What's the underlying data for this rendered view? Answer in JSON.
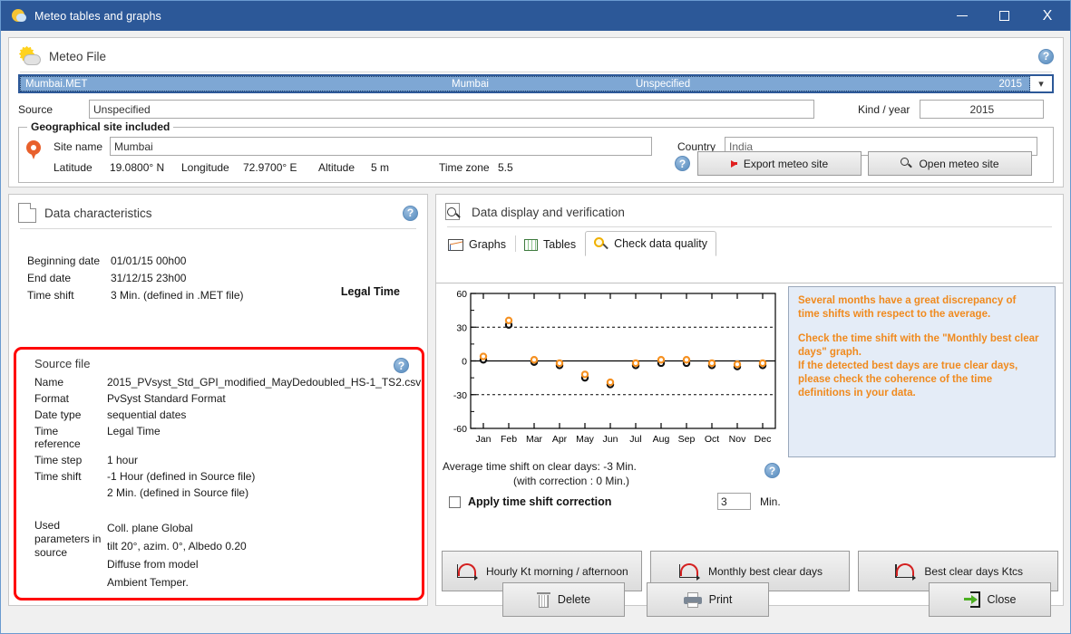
{
  "window": {
    "title": "Meteo tables and graphs",
    "icon": "sun-cloud-icon",
    "minimize": "–",
    "maximize": "□",
    "close": "X"
  },
  "meteo_file": {
    "section_title": "Meteo File",
    "file_row": {
      "file_name": "Mumbai.MET",
      "site": "Mumbai",
      "source": "Unspecified",
      "year": "2015",
      "dropdown_arrow": "chevron-down-icon"
    },
    "source_label": "Source",
    "source_value": "Unspecified",
    "kind_year_label": "Kind / year",
    "kind_year_value": "2015",
    "geo": {
      "group_title": "Geographical site included",
      "site_name_label": "Site name",
      "site_name_value": "Mumbai",
      "country_label": "Country",
      "country_value": "India",
      "latitude_label": "Latitude",
      "latitude_value": "19.0800° N",
      "longitude_label": "Longitude",
      "longitude_value": "72.9700° E",
      "altitude_label": "Altitude",
      "altitude_value": "5 m",
      "timezone_label": "Time zone",
      "timezone_value": "5.5",
      "export_button": "Export meteo site",
      "open_button": "Open meteo site"
    }
  },
  "data_characteristics": {
    "section_title": "Data characteristics",
    "legal_time": "Legal Time",
    "rows": [
      {
        "key": "Beginning date",
        "value": "01/01/15 00h00"
      },
      {
        "key": "End date",
        "value": "31/12/15 23h00"
      },
      {
        "key": "Time shift",
        "value": "3 Min. (defined in .MET file)"
      }
    ],
    "source_file": {
      "title": "Source file",
      "rows": [
        {
          "key": "Name",
          "value": "2015_PVsyst_Std_GPI_modified_MayDedoubled_HS-1_TS2.csv"
        },
        {
          "key": "Format",
          "value": "PvSyst Standard Format"
        },
        {
          "key": "Date type",
          "value": "sequential dates"
        },
        {
          "key": "Time reference",
          "value": "Legal Time"
        },
        {
          "key": "Time step",
          "value": "1 hour"
        },
        {
          "key": "Time shift",
          "value": "-1 Hour (defined in Source file)"
        },
        {
          "key": "",
          "value": "2 Min. (defined in Source file)"
        }
      ],
      "used_params_label": "Used parameters in source",
      "used_params": [
        "Coll. plane Global",
        "tilt 20°, azim. 0°, Albedo 0.20",
        "Diffuse from model",
        "Ambient Temper."
      ]
    }
  },
  "data_display": {
    "section_title": "Data display and verification",
    "tabs": [
      {
        "label": "Graphs",
        "icon": "graphs-icon",
        "active": false
      },
      {
        "label": "Tables",
        "icon": "tables-icon",
        "active": false
      },
      {
        "label": "Check data quality",
        "icon": "check-quality-icon",
        "active": true
      }
    ],
    "warning": {
      "line1": "Several months have a great discrepancy of",
      "line2": "time shifts with respect to the average.",
      "line3": "Check the time shift with the \"Monthly best clear",
      "line4": "days\" graph.",
      "line5": "If the detected best days are true clear days,",
      "line6": "please check the coherence of the time",
      "line7": "definitions in your data.",
      "color": "#f08a1e",
      "background": "#e4ecf7"
    },
    "average_shift_line1": "Average time shift on clear days: -3 Min.",
    "average_shift_line2": "(with correction : 0 Min.)",
    "apply_correction_label": "Apply time shift correction",
    "apply_correction_checked": false,
    "correction_value": "3",
    "correction_unit": "Min.",
    "action_buttons": [
      {
        "label": "Hourly Kt morning / afternoon",
        "icon": "curve-chart-icon"
      },
      {
        "label": "Monthly best clear days",
        "icon": "curve-chart-icon"
      },
      {
        "label": "Best clear days Ktcs",
        "icon": "curve-chart-icon"
      }
    ]
  },
  "footer": {
    "delete": "Delete",
    "print": "Print",
    "close": "Close"
  },
  "chart_data": {
    "type": "scatter",
    "title": "",
    "xlabel": "",
    "ylabel": "",
    "ylim": [
      -60,
      60
    ],
    "yticks": [
      -60,
      -30,
      0,
      30,
      60
    ],
    "ytick_labels": [
      "-60",
      "-30",
      "0",
      "30",
      "60"
    ],
    "gridlines": {
      "horizontal_dotted": [
        30,
        -30
      ],
      "zero_line": 0
    },
    "categories": [
      "Jan",
      "Feb",
      "Mar",
      "Apr",
      "May",
      "Jun",
      "Jul",
      "Aug",
      "Sep",
      "Oct",
      "Nov",
      "Dec"
    ],
    "series": [
      {
        "name": "orange-marker",
        "color": "#f59020",
        "values": [
          4,
          36,
          1,
          -2,
          -12,
          -19,
          -2,
          1,
          1,
          -2,
          -3,
          -2
        ]
      },
      {
        "name": "black-marker",
        "color": "#111111",
        "values": [
          1,
          32,
          -1,
          -4,
          -15,
          -21,
          -4,
          -2,
          -2,
          -4,
          -5,
          -4
        ]
      }
    ]
  }
}
